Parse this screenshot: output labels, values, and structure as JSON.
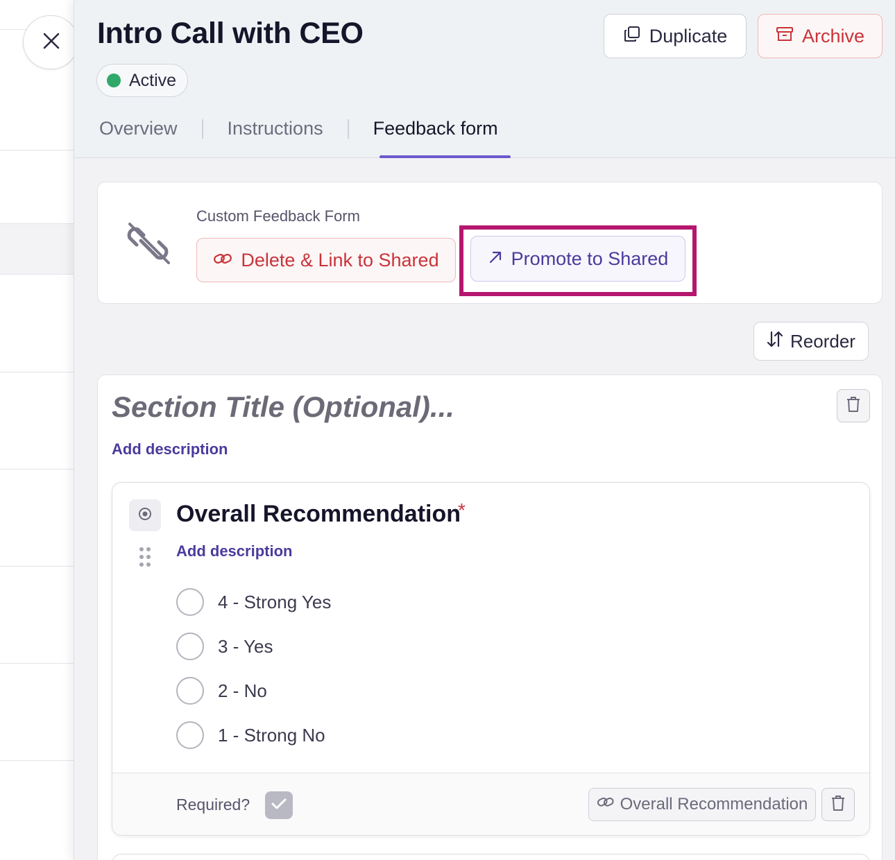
{
  "header": {
    "title": "Intro Call with CEO",
    "status": "Active",
    "duplicate_label": "Duplicate",
    "archive_label": "Archive"
  },
  "tabs": [
    {
      "label": "Overview",
      "active": false
    },
    {
      "label": "Instructions",
      "active": false
    },
    {
      "label": "Feedback form",
      "active": true
    }
  ],
  "custom_form": {
    "label": "Custom Feedback Form",
    "delete_link_label": "Delete & Link to Shared",
    "promote_label": "Promote to Shared"
  },
  "reorder_label": "Reorder",
  "section": {
    "title_placeholder": "Section Title (Optional)...",
    "add_description": "Add description"
  },
  "question": {
    "title": "Overall Recommendation",
    "required_mark": "*",
    "add_description": "Add description",
    "options": [
      "4 - Strong Yes",
      "3 - Yes",
      "2 - No",
      "1 - Strong No"
    ],
    "required_label": "Required?",
    "required": true,
    "linked_attribute": "Overall Recommendation"
  },
  "colors": {
    "accent": "#6a5acd",
    "danger": "#c8343a",
    "status_active": "#2fa86a",
    "highlight": "#b5166e"
  }
}
